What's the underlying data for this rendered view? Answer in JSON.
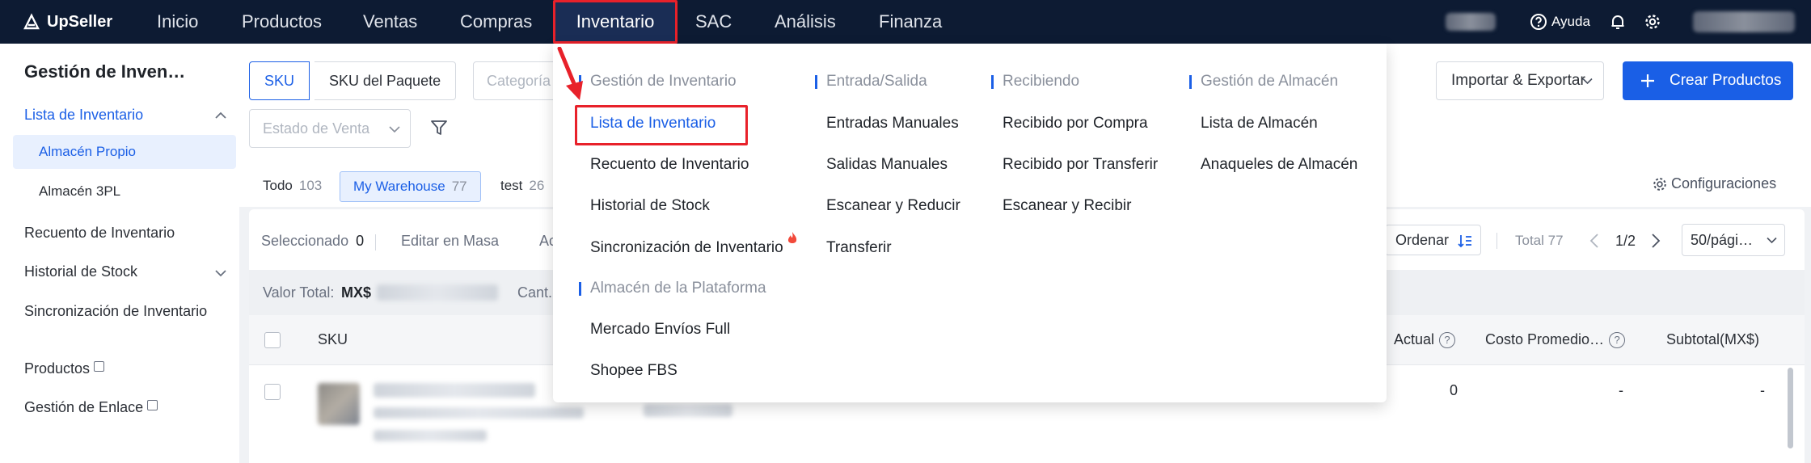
{
  "brand": {
    "name": "UpSeller"
  },
  "topnav": {
    "items": [
      "Inicio",
      "Productos",
      "Ventas",
      "Compras",
      "Inventario",
      "SAC",
      "Análisis",
      "Finanza"
    ],
    "active": "Inventario",
    "help_label": "Ayuda"
  },
  "sidebar": {
    "title": "Gestión de Inven…",
    "group_label": "Lista de Inventario",
    "sub_items": [
      "Almacén Propio",
      "Almacén 3PL"
    ],
    "items": [
      "Recuento de Inventario",
      "Historial de Stock",
      "Sincronización de Inventario",
      "Productos",
      "Gestión de Enlace"
    ]
  },
  "toolbar": {
    "tab_sku": "SKU",
    "tab_paquete": "SKU del Paquete",
    "category_placeholder": "Categoría",
    "estado_placeholder": "Estado de Venta",
    "import_export": "Importar & Exportar",
    "create": "Crear Productos"
  },
  "warehouse_tabs": [
    {
      "label": "Todo",
      "count": "103"
    },
    {
      "label": "My Warehouse",
      "count": "77"
    },
    {
      "label": "test",
      "count": "26"
    }
  ],
  "config_label": "Configuraciones",
  "bulk": {
    "selected_label": "Seleccionado",
    "selected_count": "0",
    "edit_mass": "Editar en Masa",
    "truncated": "Ac",
    "sort_label": "Ordenar",
    "total_label": "Total 77",
    "page": "1/2",
    "page_size": "50/pági…"
  },
  "summary": {
    "value_label": "Valor Total:",
    "currency": "MX$",
    "qty_label": "Cant."
  },
  "table": {
    "headers": {
      "sku": "SKU",
      "actual": "Actual",
      "cost": "Costo Promedio…",
      "subtotal": "Subtotal(MX$)"
    },
    "row": {
      "actual": "0",
      "cost": "-",
      "subtotal": "-"
    }
  },
  "dropdown": {
    "columns": [
      {
        "heading": "Gestión de Inventario",
        "links": [
          "Lista de Inventario",
          "Recuento de Inventario",
          "Historial de Stock",
          "Sincronización de Inventario"
        ]
      },
      {
        "heading": "Almacén de la Plataforma",
        "links": [
          "Mercado Envíos Full",
          "Shopee FBS"
        ]
      },
      {
        "heading": "Entrada/Salida",
        "links": [
          "Entradas Manuales",
          "Salidas Manuales",
          "Escanear y Reducir",
          "Transferir"
        ]
      },
      {
        "heading": "Recibiendo",
        "links": [
          "Recibido por Compra",
          "Recibido por Transferir",
          "Escanear y Recibir"
        ]
      },
      {
        "heading": "Gestión de Almacén",
        "links": [
          "Lista de Almacén",
          "Anaqueles de Almacén"
        ]
      }
    ],
    "active_link": "Lista de Inventario"
  },
  "colors": {
    "nav_bg": "#0d1b33",
    "accent": "#1b5fe6",
    "annotation": "#e8212a"
  }
}
